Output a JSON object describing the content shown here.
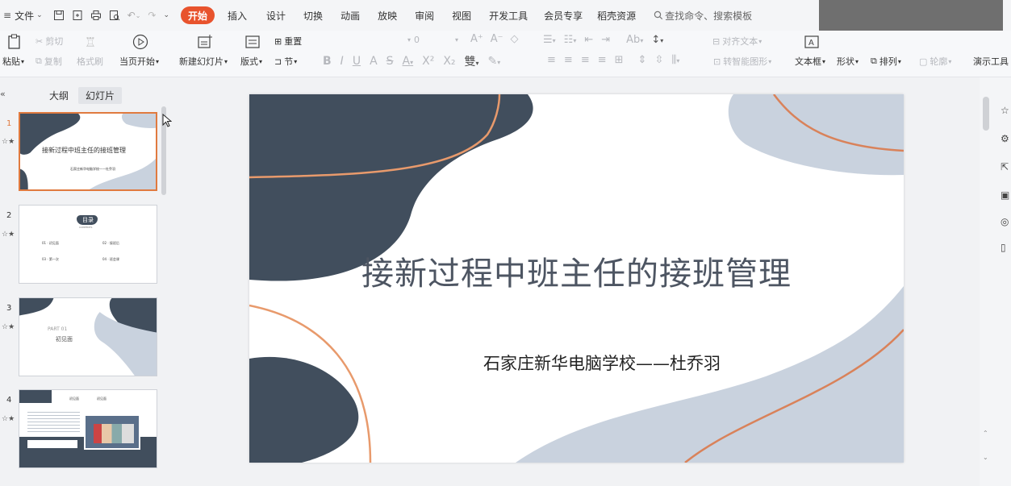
{
  "titlebar": {
    "file_menu": "文件",
    "tabs": [
      "开始",
      "插入",
      "设计",
      "切换",
      "动画",
      "放映",
      "审阅",
      "视图",
      "开发工具",
      "会员专享",
      "稻壳资源"
    ],
    "search_placeholder": "查找命令、搜索模板"
  },
  "ribbon": {
    "paste": "粘贴",
    "cut": "剪切",
    "copy": "复制",
    "format_painter": "格式刷",
    "from_current": "当页开始",
    "new_slide": "新建幻灯片",
    "layout": "版式",
    "reset": "重置",
    "section": "节",
    "font_size": "0",
    "align_text": "对齐文本",
    "smart_art": "转智能图形",
    "text_box": "文本框",
    "shape": "形状",
    "arrange": "排列",
    "outline": "轮廓",
    "present_tools": "演示工具"
  },
  "left_pane": {
    "tab_outline": "大纲",
    "tab_slides": "幻灯片",
    "thumbnails": [
      {
        "num": "1",
        "title": "接新过程中班主任的接班管理",
        "sub": "石家庄新华电脑学校——杜乔羽"
      },
      {
        "num": "2",
        "title": "目录",
        "sub": "CONTENTS",
        "items": [
          "01 · 初见面",
          "02 · 接班后",
          "03 · 第一次",
          "04 · 班会课"
        ]
      },
      {
        "num": "3",
        "part": "PART 01",
        "title": "初见面"
      },
      {
        "num": "4",
        "header": [
          "初见面",
          "初见面"
        ]
      }
    ]
  },
  "slide": {
    "title": "接新过程中班主任的接班管理",
    "subtitle": "石家庄新华电脑学校——杜乔羽"
  },
  "colors": {
    "accent": "#e8532d",
    "dark_shape": "#414e5d",
    "light_shape": "#c9d2de",
    "orange_line": "#e89a6c"
  }
}
